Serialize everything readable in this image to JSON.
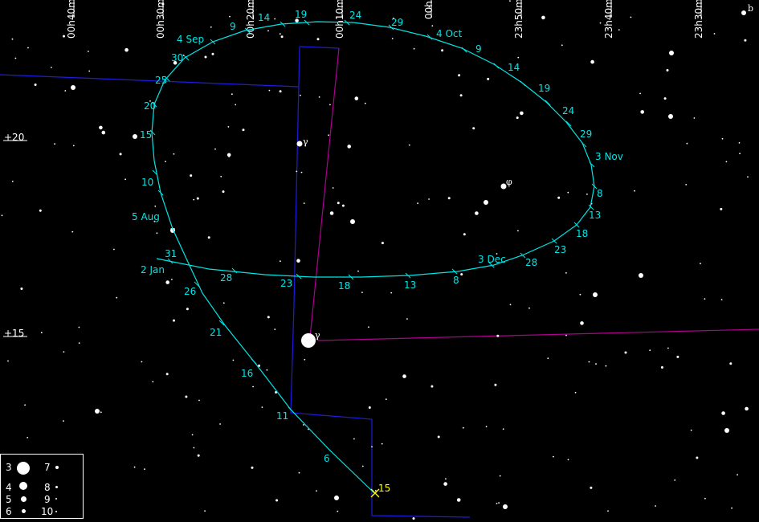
{
  "ra_labels": [
    "00h40m",
    "00h30m",
    "00h20m",
    "00h10m",
    "00h",
    "23h50m",
    "23h40m",
    "23h30m"
  ],
  "dec_labels": [
    "+20",
    "+15"
  ],
  "path_labels": [
    "19",
    "24",
    "29",
    "4 Oct",
    "9",
    "14",
    "19",
    "24",
    "29",
    "3 Nov",
    "8",
    "13",
    "18",
    "23",
    "28",
    "3 Dec",
    "8",
    "13",
    "18",
    "23",
    "28",
    "2 Jan",
    "31",
    "5 Aug",
    "10",
    "15",
    "20",
    "25",
    "30",
    "4 Sep",
    "9",
    "14",
    "26",
    "21",
    "16",
    "11",
    "6"
  ],
  "end_label": "15",
  "star_labels": {
    "upper": "γ",
    "middle": "φ",
    "lower": "γ",
    "corner": "b"
  },
  "legend": {
    "rows": [
      {
        "mag": "3",
        "mag_b": "7"
      },
      {
        "mag": "4",
        "mag_b": "8"
      },
      {
        "mag": "5",
        "mag_b": "9"
      },
      {
        "mag": "6",
        "mag_b": "10"
      }
    ]
  },
  "colors": {
    "path": "#00e5e5",
    "boundary": "#1d1ddb",
    "magenta": "#b0008f",
    "end_marker": "#ffff00"
  }
}
